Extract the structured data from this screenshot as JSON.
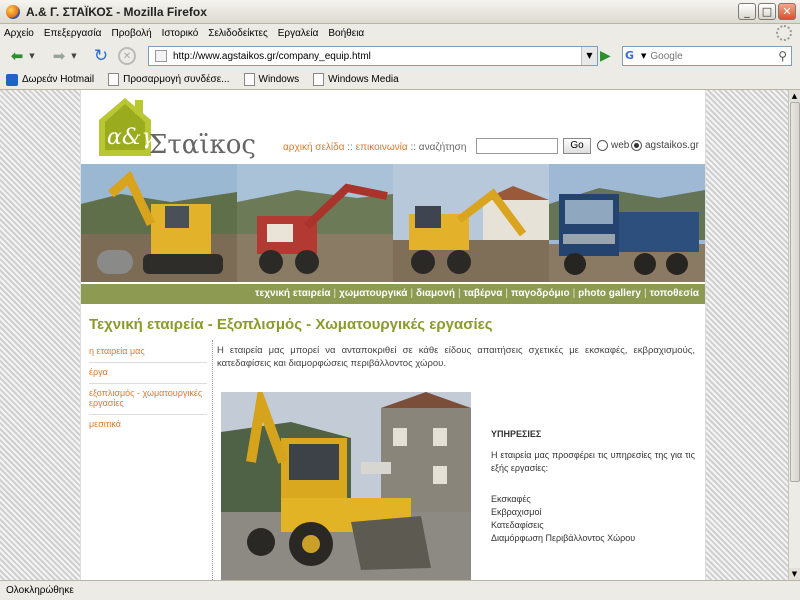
{
  "browser": {
    "window_title": "Α.& Γ. ΣΤΑΪΚΟΣ - Mozilla Firefox",
    "menu": [
      "Αρχείο",
      "Επεξεργασία",
      "Προβολή",
      "Ιστορικό",
      "Σελιδοδείκτες",
      "Εργαλεία",
      "Βοήθεια"
    ],
    "url": "http://www.agstaikos.gr/company_equip.html",
    "search_placeholder": "Google",
    "bookmarks": [
      "Δωρεάν Hotmail",
      "Προσαρμογή συνδέσε...",
      "Windows",
      "Windows Media"
    ],
    "status": "Ολοκληρώθηκε"
  },
  "site": {
    "logo_mark": "α&γ",
    "brand": "Σταϊκος",
    "topnav": {
      "home": "αρχική σελίδα",
      "contact": "επικοινωνία",
      "search_label": "αναζήτηση",
      "go": "Go",
      "radio_web": "web",
      "radio_site": "agstaikos.gr"
    },
    "main_nav": [
      "τεχνική εταιρεία",
      "χωματουργικά",
      "διαμονή",
      "ταβέρνα",
      "παγοδρόμιο",
      "photo gallery",
      "τοποθεσία"
    ],
    "page_title": "Τεχνική εταιρεία - Εξοπλισμός - Χωματουργικές εργασίες",
    "side_nav": [
      "η εταιρεία μας",
      "έργα",
      "εξοπλισμός - χωματουργικές εργασίες",
      "μεσιτικά"
    ],
    "intro": "Η εταιρεία μας μπορεί να ανταποκριθεί σε κάθε είδους απαιτήσεις σχετικές με εκσκαφές, εκβραχισμούς, κατεδαφίσεις και διαμορφώσεις περιβάλλοντος χώρου.",
    "services": {
      "heading": "ΥΠΗΡΕΣΙΕΣ",
      "description": "Η εταιρεία μας προσφέρει τις υπηρεσίες της για τις εξής εργασίες:",
      "items": [
        "Εκσκαφές",
        "Εκβραχισμοί",
        "Κατεδαφίσεις",
        "Διαμόρφωση Περιβάλλοντος Χώρου"
      ]
    }
  },
  "colors": {
    "accent_orange": "#e07a2a",
    "olive": "#8c9a52",
    "title_green": "#8c9a2a"
  }
}
